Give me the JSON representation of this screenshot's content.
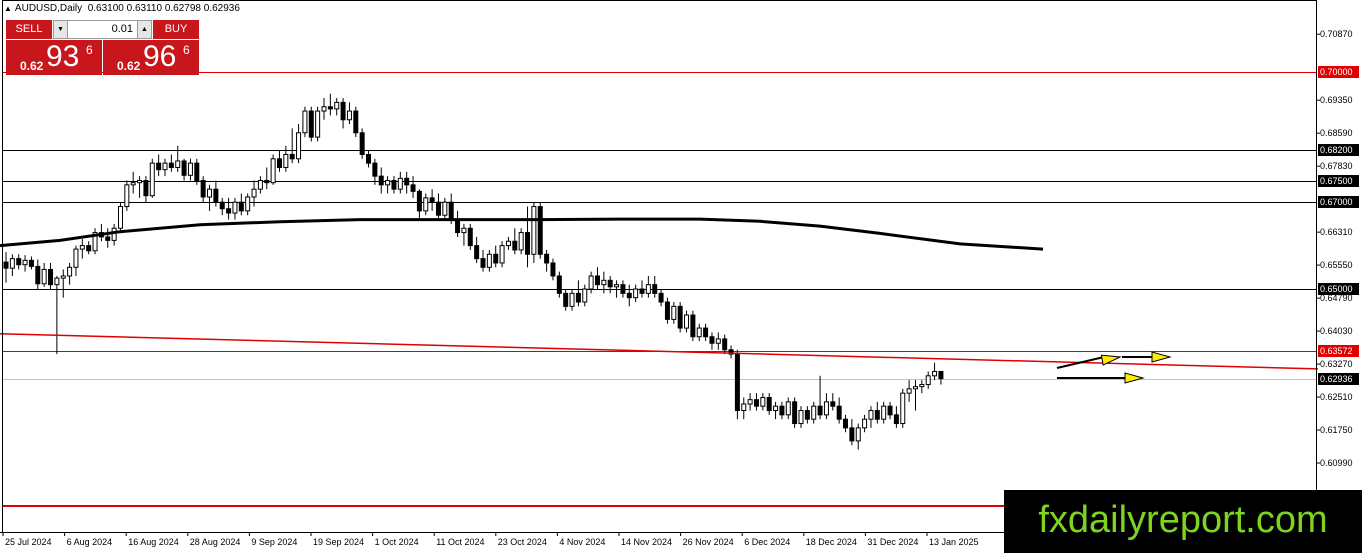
{
  "header": {
    "symbol": "AUDUSD,Daily",
    "ohlc": "0.63100 0.63110 0.62798 0.62936"
  },
  "trade_panel": {
    "sell_label": "SELL",
    "buy_label": "BUY",
    "lot_size": "0.01",
    "sell_price": {
      "prefix": "0.62",
      "big": "93",
      "sup": "6"
    },
    "buy_price": {
      "prefix": "0.62",
      "big": "96",
      "sup": "6"
    }
  },
  "price_axis": {
    "ticks": [
      "0.70870",
      "0.69350",
      "0.68590",
      "0.67830",
      "0.66310",
      "0.65550",
      "0.64790",
      "0.64030",
      "0.63270",
      "0.62510",
      "0.61750",
      "0.60990"
    ],
    "marked_levels": [
      {
        "label": "0.70000",
        "style": "red"
      },
      {
        "label": "0.68200",
        "style": "black"
      },
      {
        "label": "0.67500",
        "style": "black"
      },
      {
        "label": "0.67000",
        "style": "black"
      },
      {
        "label": "0.65000",
        "style": "black"
      },
      {
        "label": "0.63572",
        "style": "red"
      },
      {
        "label": "0.62936",
        "style": "black"
      }
    ]
  },
  "date_axis": [
    "25 Jul 2024",
    "6 Aug 2024",
    "16 Aug 2024",
    "28 Aug 2024",
    "9 Sep 2024",
    "19 Sep 2024",
    "1 Oct 2024",
    "11 Oct 2024",
    "23 Oct 2024",
    "4 Nov 2024",
    "14 Nov 2024",
    "26 Nov 2024",
    "6 Dec 2024",
    "18 Dec 2024",
    "31 Dec 2024",
    "13 Jan 2025"
  ],
  "watermark": "fxdailyreport.com",
  "colors": {
    "sell_bg": "#c8161d",
    "level_red": "#e00000",
    "arrow_yellow": "#ffee00",
    "watermark_text": "#7fd41f"
  },
  "chart_data": {
    "type": "candlestick",
    "timeframe": "Daily",
    "ylim": [
      0.604,
      0.713
    ],
    "horizontal_levels": [
      0.7,
      0.682,
      0.675,
      0.67,
      0.65,
      0.63572
    ],
    "moving_average_path": [
      [
        0,
        0.66
      ],
      [
        60,
        0.6612
      ],
      [
        120,
        0.6632
      ],
      [
        200,
        0.6648
      ],
      [
        280,
        0.6655
      ],
      [
        360,
        0.666
      ],
      [
        450,
        0.666
      ],
      [
        540,
        0.666
      ],
      [
        620,
        0.6661
      ],
      [
        700,
        0.6661
      ],
      [
        760,
        0.6656
      ],
      [
        820,
        0.6645
      ],
      [
        880,
        0.6628
      ],
      [
        960,
        0.6604
      ],
      [
        1043,
        0.6592
      ]
    ],
    "descending_trend_line": [
      [
        0,
        0.6397
      ],
      [
        1318,
        0.6316
      ]
    ],
    "candles": [
      {
        "o": 0.6562,
        "h": 0.6585,
        "l": 0.6515,
        "c": 0.6548
      },
      {
        "o": 0.6548,
        "h": 0.658,
        "l": 0.653,
        "c": 0.657
      },
      {
        "o": 0.657,
        "h": 0.658,
        "l": 0.6545,
        "c": 0.6556
      },
      {
        "o": 0.6556,
        "h": 0.6578,
        "l": 0.654,
        "c": 0.6566
      },
      {
        "o": 0.6566,
        "h": 0.6575,
        "l": 0.6545,
        "c": 0.6552
      },
      {
        "o": 0.6552,
        "h": 0.6568,
        "l": 0.65,
        "c": 0.6512
      },
      {
        "o": 0.6512,
        "h": 0.656,
        "l": 0.6505,
        "c": 0.6545
      },
      {
        "o": 0.6545,
        "h": 0.656,
        "l": 0.65,
        "c": 0.651
      },
      {
        "o": 0.651,
        "h": 0.653,
        "l": 0.635,
        "c": 0.6525
      },
      {
        "o": 0.6525,
        "h": 0.6545,
        "l": 0.648,
        "c": 0.653
      },
      {
        "o": 0.653,
        "h": 0.656,
        "l": 0.651,
        "c": 0.655
      },
      {
        "o": 0.655,
        "h": 0.66,
        "l": 0.653,
        "c": 0.6592
      },
      {
        "o": 0.6592,
        "h": 0.6615,
        "l": 0.657,
        "c": 0.66
      },
      {
        "o": 0.66,
        "h": 0.661,
        "l": 0.658,
        "c": 0.6588
      },
      {
        "o": 0.6588,
        "h": 0.664,
        "l": 0.658,
        "c": 0.663
      },
      {
        "o": 0.663,
        "h": 0.665,
        "l": 0.661,
        "c": 0.662
      },
      {
        "o": 0.662,
        "h": 0.664,
        "l": 0.6595,
        "c": 0.6612
      },
      {
        "o": 0.6612,
        "h": 0.665,
        "l": 0.66,
        "c": 0.664
      },
      {
        "o": 0.664,
        "h": 0.67,
        "l": 0.663,
        "c": 0.669
      },
      {
        "o": 0.669,
        "h": 0.675,
        "l": 0.668,
        "c": 0.674
      },
      {
        "o": 0.674,
        "h": 0.677,
        "l": 0.672,
        "c": 0.6745
      },
      {
        "o": 0.6745,
        "h": 0.676,
        "l": 0.671,
        "c": 0.675
      },
      {
        "o": 0.675,
        "h": 0.676,
        "l": 0.67,
        "c": 0.6715
      },
      {
        "o": 0.6715,
        "h": 0.68,
        "l": 0.671,
        "c": 0.679
      },
      {
        "o": 0.679,
        "h": 0.681,
        "l": 0.676,
        "c": 0.6775
      },
      {
        "o": 0.6775,
        "h": 0.68,
        "l": 0.676,
        "c": 0.679
      },
      {
        "o": 0.679,
        "h": 0.681,
        "l": 0.677,
        "c": 0.678
      },
      {
        "o": 0.678,
        "h": 0.683,
        "l": 0.677,
        "c": 0.6795
      },
      {
        "o": 0.6795,
        "h": 0.68,
        "l": 0.675,
        "c": 0.6762
      },
      {
        "o": 0.6762,
        "h": 0.68,
        "l": 0.675,
        "c": 0.679
      },
      {
        "o": 0.679,
        "h": 0.68,
        "l": 0.674,
        "c": 0.675
      },
      {
        "o": 0.675,
        "h": 0.676,
        "l": 0.67,
        "c": 0.6712
      },
      {
        "o": 0.6712,
        "h": 0.674,
        "l": 0.668,
        "c": 0.673
      },
      {
        "o": 0.673,
        "h": 0.675,
        "l": 0.669,
        "c": 0.67
      },
      {
        "o": 0.67,
        "h": 0.671,
        "l": 0.667,
        "c": 0.6685
      },
      {
        "o": 0.6685,
        "h": 0.671,
        "l": 0.666,
        "c": 0.6675
      },
      {
        "o": 0.6675,
        "h": 0.671,
        "l": 0.666,
        "c": 0.67
      },
      {
        "o": 0.67,
        "h": 0.672,
        "l": 0.667,
        "c": 0.668
      },
      {
        "o": 0.668,
        "h": 0.672,
        "l": 0.667,
        "c": 0.6712
      },
      {
        "o": 0.6712,
        "h": 0.675,
        "l": 0.669,
        "c": 0.673
      },
      {
        "o": 0.673,
        "h": 0.676,
        "l": 0.672,
        "c": 0.675
      },
      {
        "o": 0.675,
        "h": 0.678,
        "l": 0.673,
        "c": 0.6745
      },
      {
        "o": 0.6745,
        "h": 0.681,
        "l": 0.674,
        "c": 0.68
      },
      {
        "o": 0.68,
        "h": 0.682,
        "l": 0.677,
        "c": 0.678
      },
      {
        "o": 0.678,
        "h": 0.683,
        "l": 0.677,
        "c": 0.681
      },
      {
        "o": 0.681,
        "h": 0.687,
        "l": 0.679,
        "c": 0.68
      },
      {
        "o": 0.68,
        "h": 0.688,
        "l": 0.679,
        "c": 0.686
      },
      {
        "o": 0.686,
        "h": 0.692,
        "l": 0.685,
        "c": 0.691
      },
      {
        "o": 0.691,
        "h": 0.692,
        "l": 0.684,
        "c": 0.685
      },
      {
        "o": 0.685,
        "h": 0.692,
        "l": 0.684,
        "c": 0.691
      },
      {
        "o": 0.691,
        "h": 0.694,
        "l": 0.689,
        "c": 0.692
      },
      {
        "o": 0.692,
        "h": 0.695,
        "l": 0.69,
        "c": 0.6915
      },
      {
        "o": 0.6915,
        "h": 0.694,
        "l": 0.69,
        "c": 0.693
      },
      {
        "o": 0.693,
        "h": 0.694,
        "l": 0.687,
        "c": 0.689
      },
      {
        "o": 0.689,
        "h": 0.693,
        "l": 0.688,
        "c": 0.691
      },
      {
        "o": 0.691,
        "h": 0.692,
        "l": 0.685,
        "c": 0.686
      },
      {
        "o": 0.686,
        "h": 0.687,
        "l": 0.68,
        "c": 0.681
      },
      {
        "o": 0.681,
        "h": 0.682,
        "l": 0.678,
        "c": 0.679
      },
      {
        "o": 0.679,
        "h": 0.68,
        "l": 0.674,
        "c": 0.676
      },
      {
        "o": 0.676,
        "h": 0.678,
        "l": 0.672,
        "c": 0.674
      },
      {
        "o": 0.674,
        "h": 0.676,
        "l": 0.672,
        "c": 0.675
      },
      {
        "o": 0.675,
        "h": 0.676,
        "l": 0.672,
        "c": 0.673
      },
      {
        "o": 0.673,
        "h": 0.677,
        "l": 0.672,
        "c": 0.6755
      },
      {
        "o": 0.6755,
        "h": 0.677,
        "l": 0.672,
        "c": 0.674
      },
      {
        "o": 0.674,
        "h": 0.676,
        "l": 0.671,
        "c": 0.6725
      },
      {
        "o": 0.6725,
        "h": 0.673,
        "l": 0.666,
        "c": 0.668
      },
      {
        "o": 0.668,
        "h": 0.672,
        "l": 0.667,
        "c": 0.671
      },
      {
        "o": 0.671,
        "h": 0.673,
        "l": 0.668,
        "c": 0.67
      },
      {
        "o": 0.67,
        "h": 0.672,
        "l": 0.666,
        "c": 0.667
      },
      {
        "o": 0.667,
        "h": 0.671,
        "l": 0.666,
        "c": 0.67
      },
      {
        "o": 0.67,
        "h": 0.672,
        "l": 0.665,
        "c": 0.666
      },
      {
        "o": 0.666,
        "h": 0.668,
        "l": 0.662,
        "c": 0.663
      },
      {
        "o": 0.663,
        "h": 0.665,
        "l": 0.66,
        "c": 0.664
      },
      {
        "o": 0.664,
        "h": 0.665,
        "l": 0.659,
        "c": 0.66
      },
      {
        "o": 0.66,
        "h": 0.662,
        "l": 0.656,
        "c": 0.657
      },
      {
        "o": 0.657,
        "h": 0.659,
        "l": 0.654,
        "c": 0.655
      },
      {
        "o": 0.655,
        "h": 0.659,
        "l": 0.654,
        "c": 0.658
      },
      {
        "o": 0.658,
        "h": 0.66,
        "l": 0.655,
        "c": 0.656
      },
      {
        "o": 0.656,
        "h": 0.661,
        "l": 0.655,
        "c": 0.66
      },
      {
        "o": 0.66,
        "h": 0.662,
        "l": 0.659,
        "c": 0.661
      },
      {
        "o": 0.661,
        "h": 0.664,
        "l": 0.658,
        "c": 0.659
      },
      {
        "o": 0.659,
        "h": 0.664,
        "l": 0.658,
        "c": 0.663
      },
      {
        "o": 0.663,
        "h": 0.669,
        "l": 0.655,
        "c": 0.658
      },
      {
        "o": 0.658,
        "h": 0.67,
        "l": 0.656,
        "c": 0.669
      },
      {
        "o": 0.669,
        "h": 0.67,
        "l": 0.657,
        "c": 0.658
      },
      {
        "o": 0.658,
        "h": 0.659,
        "l": 0.654,
        "c": 0.656
      },
      {
        "o": 0.656,
        "h": 0.657,
        "l": 0.652,
        "c": 0.653
      },
      {
        "o": 0.653,
        "h": 0.654,
        "l": 0.648,
        "c": 0.649
      },
      {
        "o": 0.649,
        "h": 0.65,
        "l": 0.645,
        "c": 0.646
      },
      {
        "o": 0.646,
        "h": 0.65,
        "l": 0.645,
        "c": 0.649
      },
      {
        "o": 0.649,
        "h": 0.652,
        "l": 0.646,
        "c": 0.647
      },
      {
        "o": 0.647,
        "h": 0.651,
        "l": 0.646,
        "c": 0.65
      },
      {
        "o": 0.65,
        "h": 0.654,
        "l": 0.649,
        "c": 0.653
      },
      {
        "o": 0.653,
        "h": 0.655,
        "l": 0.65,
        "c": 0.651
      },
      {
        "o": 0.651,
        "h": 0.654,
        "l": 0.649,
        "c": 0.652
      },
      {
        "o": 0.652,
        "h": 0.653,
        "l": 0.649,
        "c": 0.6505
      },
      {
        "o": 0.6505,
        "h": 0.652,
        "l": 0.648,
        "c": 0.651
      },
      {
        "o": 0.651,
        "h": 0.652,
        "l": 0.648,
        "c": 0.649
      },
      {
        "o": 0.649,
        "h": 0.651,
        "l": 0.646,
        "c": 0.648
      },
      {
        "o": 0.648,
        "h": 0.651,
        "l": 0.647,
        "c": 0.65
      },
      {
        "o": 0.65,
        "h": 0.652,
        "l": 0.648,
        "c": 0.649
      },
      {
        "o": 0.649,
        "h": 0.653,
        "l": 0.648,
        "c": 0.651
      },
      {
        "o": 0.651,
        "h": 0.653,
        "l": 0.648,
        "c": 0.649
      },
      {
        "o": 0.649,
        "h": 0.65,
        "l": 0.646,
        "c": 0.647
      },
      {
        "o": 0.647,
        "h": 0.648,
        "l": 0.642,
        "c": 0.643
      },
      {
        "o": 0.643,
        "h": 0.647,
        "l": 0.642,
        "c": 0.646
      },
      {
        "o": 0.646,
        "h": 0.647,
        "l": 0.64,
        "c": 0.641
      },
      {
        "o": 0.641,
        "h": 0.645,
        "l": 0.64,
        "c": 0.644
      },
      {
        "o": 0.644,
        "h": 0.645,
        "l": 0.638,
        "c": 0.639
      },
      {
        "o": 0.639,
        "h": 0.642,
        "l": 0.638,
        "c": 0.641
      },
      {
        "o": 0.641,
        "h": 0.642,
        "l": 0.638,
        "c": 0.639
      },
      {
        "o": 0.639,
        "h": 0.64,
        "l": 0.636,
        "c": 0.6375
      },
      {
        "o": 0.6375,
        "h": 0.64,
        "l": 0.636,
        "c": 0.6385
      },
      {
        "o": 0.6385,
        "h": 0.6395,
        "l": 0.635,
        "c": 0.636
      },
      {
        "o": 0.636,
        "h": 0.637,
        "l": 0.634,
        "c": 0.635
      },
      {
        "o": 0.635,
        "h": 0.636,
        "l": 0.62,
        "c": 0.622
      },
      {
        "o": 0.622,
        "h": 0.625,
        "l": 0.62,
        "c": 0.6235
      },
      {
        "o": 0.6235,
        "h": 0.626,
        "l": 0.622,
        "c": 0.6245
      },
      {
        "o": 0.6245,
        "h": 0.626,
        "l": 0.622,
        "c": 0.623
      },
      {
        "o": 0.623,
        "h": 0.626,
        "l": 0.622,
        "c": 0.625
      },
      {
        "o": 0.625,
        "h": 0.626,
        "l": 0.621,
        "c": 0.622
      },
      {
        "o": 0.622,
        "h": 0.624,
        "l": 0.62,
        "c": 0.623
      },
      {
        "o": 0.623,
        "h": 0.624,
        "l": 0.62,
        "c": 0.621
      },
      {
        "o": 0.621,
        "h": 0.625,
        "l": 0.62,
        "c": 0.624
      },
      {
        "o": 0.624,
        "h": 0.625,
        "l": 0.618,
        "c": 0.619
      },
      {
        "o": 0.619,
        "h": 0.623,
        "l": 0.618,
        "c": 0.622
      },
      {
        "o": 0.622,
        "h": 0.623,
        "l": 0.619,
        "c": 0.62
      },
      {
        "o": 0.62,
        "h": 0.624,
        "l": 0.619,
        "c": 0.623
      },
      {
        "o": 0.623,
        "h": 0.63,
        "l": 0.62,
        "c": 0.621
      },
      {
        "o": 0.621,
        "h": 0.626,
        "l": 0.62,
        "c": 0.624
      },
      {
        "o": 0.624,
        "h": 0.626,
        "l": 0.622,
        "c": 0.623
      },
      {
        "o": 0.623,
        "h": 0.625,
        "l": 0.619,
        "c": 0.62
      },
      {
        "o": 0.62,
        "h": 0.621,
        "l": 0.617,
        "c": 0.618
      },
      {
        "o": 0.618,
        "h": 0.62,
        "l": 0.614,
        "c": 0.615
      },
      {
        "o": 0.615,
        "h": 0.619,
        "l": 0.613,
        "c": 0.618
      },
      {
        "o": 0.618,
        "h": 0.621,
        "l": 0.617,
        "c": 0.62
      },
      {
        "o": 0.62,
        "h": 0.623,
        "l": 0.618,
        "c": 0.622
      },
      {
        "o": 0.622,
        "h": 0.624,
        "l": 0.619,
        "c": 0.62
      },
      {
        "o": 0.62,
        "h": 0.624,
        "l": 0.619,
        "c": 0.623
      },
      {
        "o": 0.623,
        "h": 0.624,
        "l": 0.62,
        "c": 0.621
      },
      {
        "o": 0.621,
        "h": 0.623,
        "l": 0.618,
        "c": 0.619
      },
      {
        "o": 0.619,
        "h": 0.627,
        "l": 0.618,
        "c": 0.626
      },
      {
        "o": 0.626,
        "h": 0.629,
        "l": 0.624,
        "c": 0.627
      },
      {
        "o": 0.627,
        "h": 0.629,
        "l": 0.622,
        "c": 0.6275
      },
      {
        "o": 0.6275,
        "h": 0.629,
        "l": 0.626,
        "c": 0.628
      },
      {
        "o": 0.628,
        "h": 0.631,
        "l": 0.627,
        "c": 0.63
      },
      {
        "o": 0.63,
        "h": 0.633,
        "l": 0.629,
        "c": 0.631
      },
      {
        "o": 0.631,
        "h": 0.6311,
        "l": 0.62798,
        "c": 0.62936
      }
    ]
  }
}
